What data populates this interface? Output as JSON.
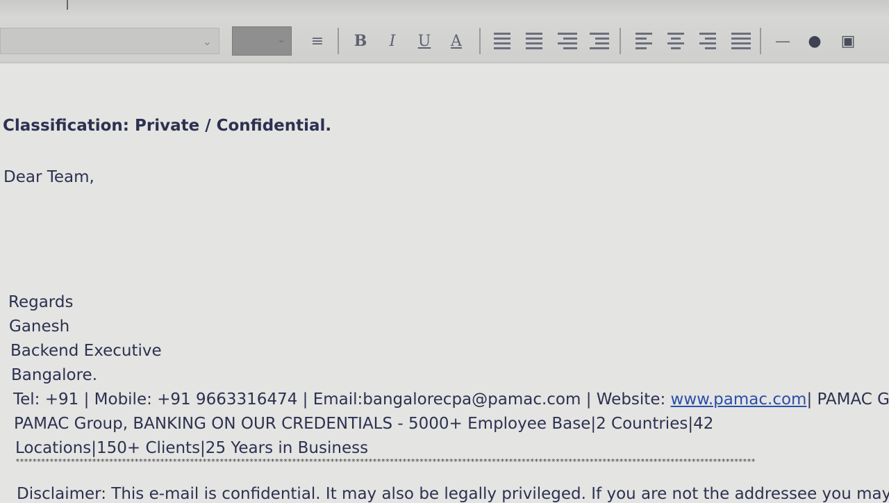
{
  "toolbar": {
    "buttons": [
      {
        "name": "line-spacing-button",
        "icon": "line-spacing-icon",
        "glyph": "≡"
      },
      {
        "name": "bold-button",
        "icon": "bold-icon",
        "glyph": "B"
      },
      {
        "name": "italic-button",
        "icon": "italic-icon",
        "glyph": "I"
      },
      {
        "name": "underline-button",
        "icon": "underline-icon",
        "glyph": "U"
      },
      {
        "name": "font-color-button",
        "icon": "font-color-icon",
        "glyph": "A"
      },
      {
        "name": "numbered-list-button",
        "icon": "numbered-list-icon",
        "glyph": ""
      },
      {
        "name": "bulleted-list-button",
        "icon": "bulleted-list-icon",
        "glyph": ""
      },
      {
        "name": "decrease-indent-button",
        "icon": "outdent-icon",
        "glyph": ""
      },
      {
        "name": "increase-indent-button",
        "icon": "indent-icon",
        "glyph": ""
      },
      {
        "name": "align-left-button",
        "icon": "align-left-icon",
        "glyph": ""
      },
      {
        "name": "align-center-button",
        "icon": "align-center-icon",
        "glyph": ""
      },
      {
        "name": "align-right-button",
        "icon": "align-right-icon",
        "glyph": ""
      },
      {
        "name": "justify-button",
        "icon": "justify-icon",
        "glyph": ""
      },
      {
        "name": "horizontal-rule-button",
        "icon": "horizontal-rule-icon",
        "glyph": "—"
      },
      {
        "name": "insert-emoji-button",
        "icon": "emoji-icon",
        "glyph": "●"
      },
      {
        "name": "insert-image-button",
        "icon": "image-icon",
        "glyph": "▣"
      }
    ]
  },
  "email": {
    "classification": "Classification: Private / Confidential.",
    "greeting": "Dear Team,",
    "signature": {
      "regards": "Regards",
      "name": "Ganesh",
      "title": "Backend Executive",
      "city": "Bangalore.",
      "contact_prefix": "Tel: +91 | Mobile: +91 9663316474 | Email:bangalorecpa@pamac.com | Website: ",
      "website": "www.pamac.com",
      "contact_suffix": "| PAMAC G",
      "tagline_1": "PAMAC Group, BANKING ON OUR CREDENTIALS - 5000+ Employee Base|2 Countries|42",
      "tagline_2": "Locations|150+ Clients|25 Years in Business"
    },
    "stars": "******************************************************************************************************************************************************************************",
    "disclaimer": "Disclaimer: This e-mail is confidential. It may also be legally privileged. If you are not the addressee you may r"
  },
  "colors": {
    "text": "#2c3150",
    "link": "#2a4fa8",
    "background": "#e4e4e2"
  }
}
